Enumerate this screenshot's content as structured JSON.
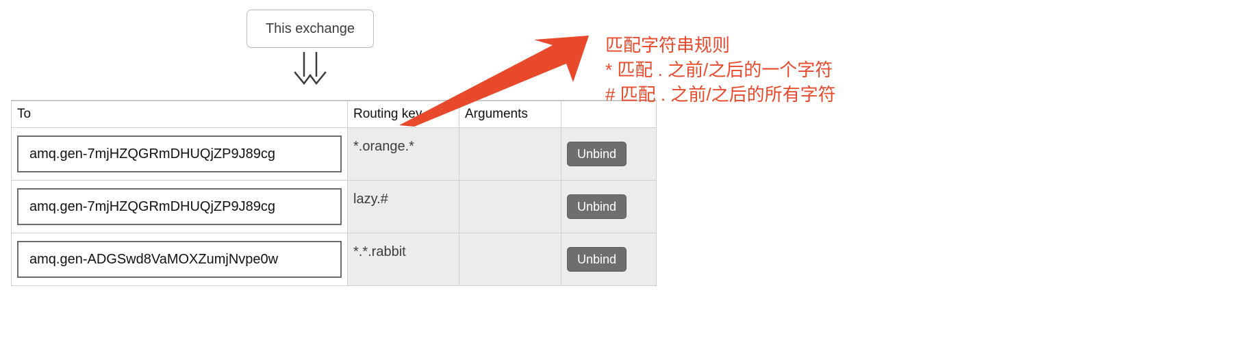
{
  "exchange_box": {
    "label": "This exchange"
  },
  "flow_arrow": {
    "icon": "double-down-arrow-icon"
  },
  "table": {
    "columns": [
      {
        "key": "to",
        "label": "To"
      },
      {
        "key": "routing_key",
        "label": "Routing key"
      },
      {
        "key": "arguments",
        "label": "Arguments"
      },
      {
        "key": "actions",
        "label": ""
      }
    ],
    "rows": [
      {
        "to": "amq.gen-7mjHZQGRmDHUQjZP9J89cg",
        "routing_key": "*.orange.*",
        "arguments": "",
        "action_label": "Unbind"
      },
      {
        "to": "amq.gen-7mjHZQGRmDHUQjZP9J89cg",
        "routing_key": "lazy.#",
        "arguments": "",
        "action_label": "Unbind"
      },
      {
        "to": "amq.gen-ADGSwd8VaMOXZumjNvpe0w",
        "routing_key": "*.*.rabbit",
        "arguments": "",
        "action_label": "Unbind"
      }
    ]
  },
  "annotation": {
    "arrow_icon": "red-arrow-pointing-up-left-icon",
    "color": "#e8492a",
    "lines": [
      "匹配字符串规则",
      "* 匹配 . 之前/之后的一个字符",
      "# 匹配 . 之前/之后的所有字符"
    ]
  }
}
